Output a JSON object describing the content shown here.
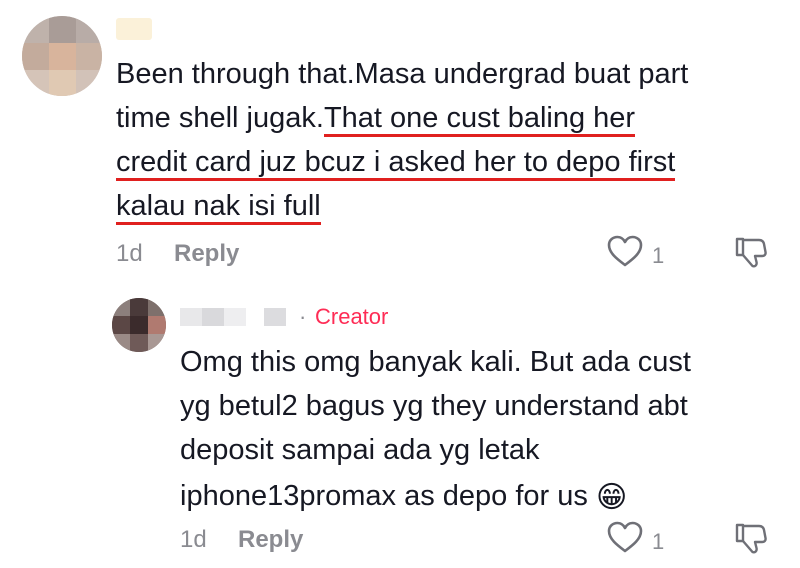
{
  "comment": {
    "text_line1": "Been through that.Masa undergrad buat part",
    "text_line2_plain": "time shell jugak.",
    "text_line2_underlined": "That one cust baling her",
    "text_line3_underlined": "credit card juz bcuz i asked her to depo first",
    "text_line4_underlined": "kalau nak isi full",
    "time": "1d",
    "reply_label": "Reply",
    "like_count": "1",
    "underline_color": "#e0201f"
  },
  "reply": {
    "separator": "·",
    "badge": "Creator",
    "text_line1": "Omg this omg banyak kali. But ada cust",
    "text_line2": "yg betul2 bagus yg they understand abt",
    "text_line3": "deposit sampai ada yg letak",
    "text_line4": "iphone13promax as depo for us",
    "emoji": "😁",
    "time": "1d",
    "reply_label": "Reply",
    "like_count": "1",
    "badge_color": "#fe2c55"
  },
  "icons": {
    "like": "heart-outline-icon",
    "dislike": "thumbs-down-outline-icon"
  }
}
